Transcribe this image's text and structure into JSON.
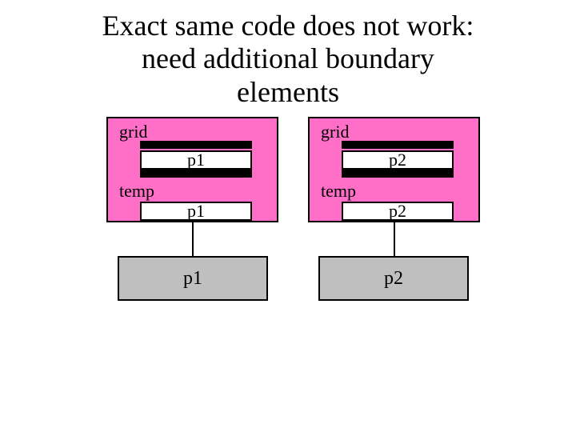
{
  "title_line1": "Exact same code does not work:",
  "title_line2": "need additional boundary",
  "title_line3": "elements",
  "left": {
    "grid_label": "grid",
    "grid_value": "p1",
    "temp_label": "temp",
    "temp_value": "p1",
    "bottom_value": "p1"
  },
  "right": {
    "grid_label": "grid",
    "grid_value": "p2",
    "temp_label": "temp",
    "temp_value": "p2",
    "bottom_value": "p2"
  },
  "colors": {
    "pink": "#ff6ec7",
    "grey": "#bfbfbf"
  }
}
